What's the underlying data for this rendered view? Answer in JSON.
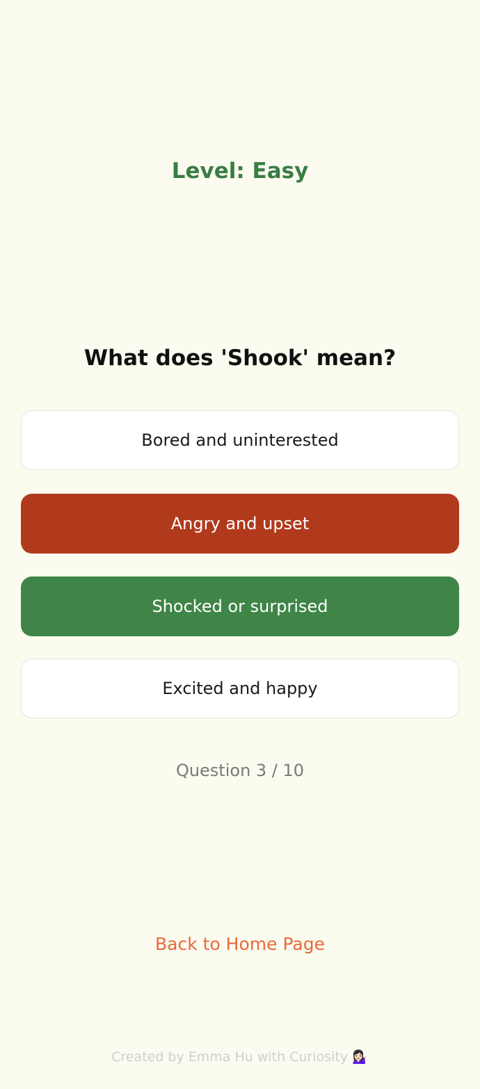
{
  "level": {
    "label": "Level: Easy"
  },
  "question": {
    "text": "What does 'Shook' mean?"
  },
  "options": [
    {
      "label": "Bored and uninterested",
      "state": "neutral"
    },
    {
      "label": "Angry and upset",
      "state": "wrong"
    },
    {
      "label": "Shocked or surprised",
      "state": "correct"
    },
    {
      "label": "Excited and happy",
      "state": "neutral"
    }
  ],
  "progress": {
    "text": "Question 3 / 10",
    "current": 3,
    "total": 10
  },
  "navigation": {
    "back_label": "Back to Home Page"
  },
  "footer": {
    "text": "Created by Emma Hu with Curiosity",
    "emoji": "💁🏻‍♀️"
  },
  "colors": {
    "background": "#fbfbef",
    "level": "#3a7d44",
    "wrong": "#b23a1c",
    "correct": "#3f8547",
    "link": "#e8693b"
  }
}
